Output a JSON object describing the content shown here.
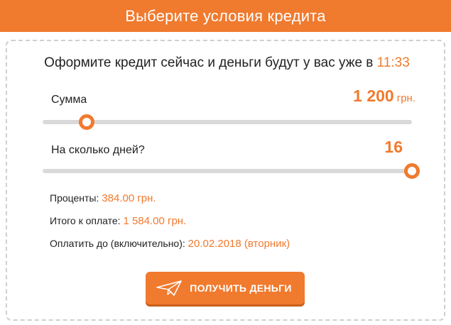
{
  "header": {
    "title": "Выберите условия кредита"
  },
  "headline": {
    "text": "Оформите кредит сейчас и деньги будут у вас уже в",
    "time": "11:33"
  },
  "amount": {
    "label": "Сумма",
    "value": "1 200",
    "unit": "грн.",
    "slider_fraction": 0.12
  },
  "days": {
    "label": "На сколько дней?",
    "value": "16",
    "slider_fraction": 1.0
  },
  "summary": {
    "interest_label": "Проценты:",
    "interest_value": "384.00 грн.",
    "total_label": "Итого к оплате:",
    "total_value": "1 584.00 грн.",
    "due_label": "Оплатить до (включительно):",
    "due_value": "20.02.2018 (вторник)"
  },
  "cta": {
    "label": "ПОЛУЧИТЬ ДЕНЬГИ",
    "icon": "paper-plane-icon"
  },
  "colors": {
    "accent": "#f07a2e",
    "track": "#d9d9d9",
    "text": "#222222"
  }
}
